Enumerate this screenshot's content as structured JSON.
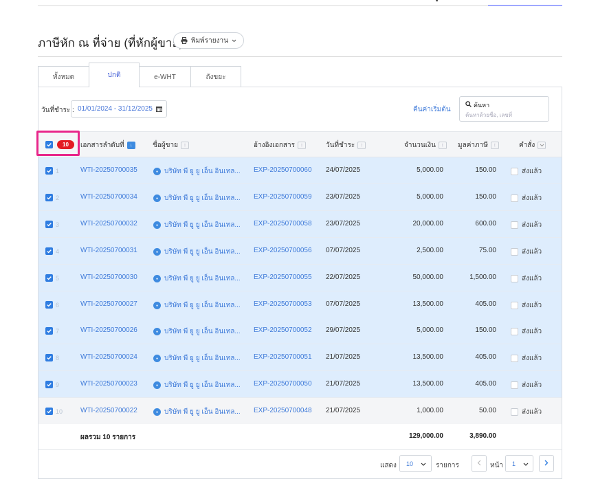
{
  "page": {
    "title": "ภาษีหัก ณ ที่จ่าย (ที่หักผู้ขาย)",
    "print_label": "พิมพ์รายงาน"
  },
  "tabs": [
    {
      "label": "ทั้งหมด",
      "active": false
    },
    {
      "label": "ปกติ",
      "active": true
    },
    {
      "label": "e-WHT",
      "active": false
    },
    {
      "label": "ถังขยะ",
      "active": false
    }
  ],
  "filters": {
    "date_label": "วันที่ชำระ :",
    "date_range": "01/01/2024 - 31/12/2025",
    "reset_label": "คืนค่าเริ่มต้น",
    "search_label": "ค้นหา",
    "search_placeholder": "ค้นหาด้วยชื่อ, เลขที่"
  },
  "table": {
    "selected_count": "10",
    "columns": {
      "doc_no": "เอกสารลำดับที่",
      "vendor": "ชื่อผู้ขาย",
      "ref": "อ้างอิงเอกสาร",
      "pay_date": "วันที่ชำระ",
      "amount": "จำนวนเงิน",
      "tax": "มูลค่าภาษี",
      "command": "คำสั่ง"
    },
    "rows": [
      {
        "idx": "1",
        "doc": "WTI-20250700035",
        "vendor": "บริษัท พี ยู ยู เอ็น อินเทล...",
        "ref": "EXP-20250700060",
        "date": "24/07/2025",
        "amount": "5,000.00",
        "tax": "150.00",
        "cmd": "ส่งแล้ว",
        "highlight": true
      },
      {
        "idx": "2",
        "doc": "WTI-20250700034",
        "vendor": "บริษัท พี ยู ยู เอ็น อินเทล...",
        "ref": "EXP-20250700059",
        "date": "23/07/2025",
        "amount": "5,000.00",
        "tax": "150.00",
        "cmd": "ส่งแล้ว",
        "highlight": true
      },
      {
        "idx": "3",
        "doc": "WTI-20250700032",
        "vendor": "บริษัท พี ยู ยู เอ็น อินเทล...",
        "ref": "EXP-20250700058",
        "date": "23/07/2025",
        "amount": "20,000.00",
        "tax": "600.00",
        "cmd": "ส่งแล้ว",
        "highlight": true
      },
      {
        "idx": "4",
        "doc": "WTI-20250700031",
        "vendor": "บริษัท พี ยู ยู เอ็น อินเทล...",
        "ref": "EXP-20250700056",
        "date": "07/07/2025",
        "amount": "2,500.00",
        "tax": "75.00",
        "cmd": "ส่งแล้ว",
        "highlight": true
      },
      {
        "idx": "5",
        "doc": "WTI-20250700030",
        "vendor": "บริษัท พี ยู ยู เอ็น อินเทล...",
        "ref": "EXP-20250700055",
        "date": "22/07/2025",
        "amount": "50,000.00",
        "tax": "1,500.00",
        "cmd": "ส่งแล้ว",
        "highlight": true
      },
      {
        "idx": "6",
        "doc": "WTI-20250700027",
        "vendor": "บริษัท พี ยู ยู เอ็น อินเทล...",
        "ref": "EXP-20250700053",
        "date": "07/07/2025",
        "amount": "13,500.00",
        "tax": "405.00",
        "cmd": "ส่งแล้ว",
        "highlight": true
      },
      {
        "idx": "7",
        "doc": "WTI-20250700026",
        "vendor": "บริษัท พี ยู ยู เอ็น อินเทล...",
        "ref": "EXP-20250700052",
        "date": "29/07/2025",
        "amount": "5,000.00",
        "tax": "150.00",
        "cmd": "ส่งแล้ว",
        "highlight": true
      },
      {
        "idx": "8",
        "doc": "WTI-20250700024",
        "vendor": "บริษัท พี ยู ยู เอ็น อินเทล...",
        "ref": "EXP-20250700051",
        "date": "21/07/2025",
        "amount": "13,500.00",
        "tax": "405.00",
        "cmd": "ส่งแล้ว",
        "highlight": true
      },
      {
        "idx": "9",
        "doc": "WTI-20250700023",
        "vendor": "บริษัท พี ยู ยู เอ็น อินเทล...",
        "ref": "EXP-20250700050",
        "date": "21/07/2025",
        "amount": "13,500.00",
        "tax": "405.00",
        "cmd": "ส่งแล้ว",
        "highlight": true
      },
      {
        "idx": "10",
        "doc": "WTI-20250700022",
        "vendor": "บริษัท พี ยู ยู เอ็น อินเทล...",
        "ref": "EXP-20250700048",
        "date": "21/07/2025",
        "amount": "1,000.00",
        "tax": "50.00",
        "cmd": "ส่งแล้ว",
        "highlight": false
      }
    ],
    "total_label": "ผลรวม 10 รายการ",
    "total_amount": "129,000.00",
    "total_tax": "3,890.00"
  },
  "pager": {
    "show_label": "แสดง",
    "page_size": "10",
    "items_label": "รายการ",
    "page_label": "หน้า",
    "page": "1"
  },
  "colors": {
    "accent": "#3e7ad9",
    "selected_row": "#deedfd",
    "highlight_border": "#e8268a",
    "badge": "#e31b23"
  }
}
